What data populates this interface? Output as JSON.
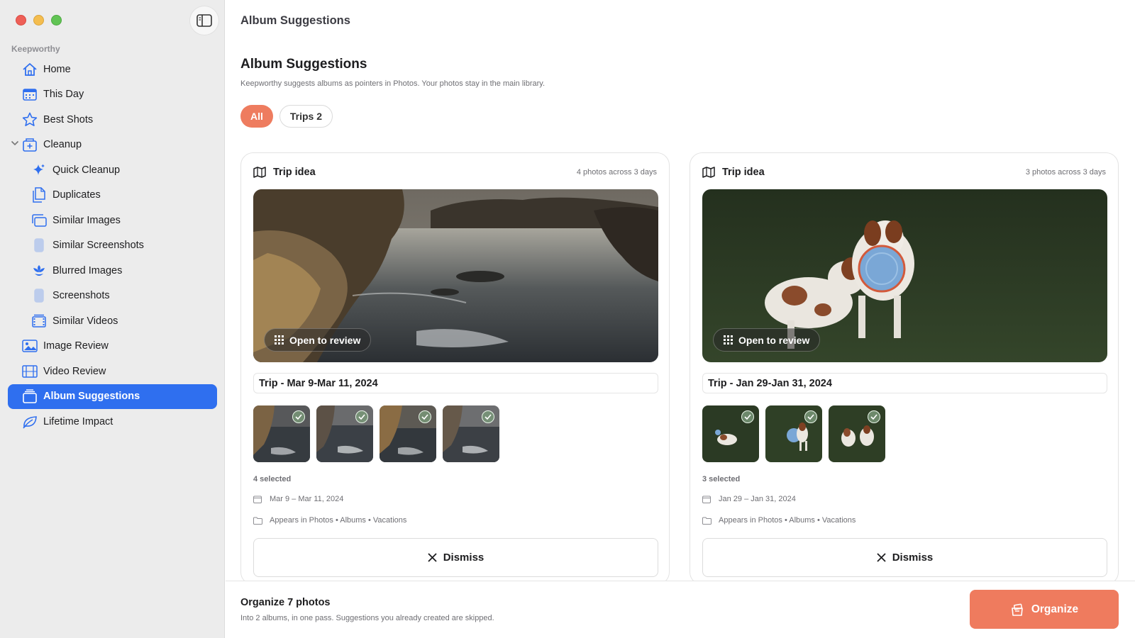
{
  "window": {
    "title": "Album Suggestions"
  },
  "sidebar": {
    "section_label": "Keepworthy",
    "items": [
      {
        "label": "Home",
        "icon": "house-icon"
      },
      {
        "label": "This Day",
        "icon": "calendar-icon"
      },
      {
        "label": "Best Shots",
        "icon": "star-icon"
      },
      {
        "label": "Cleanup",
        "icon": "cleanup-icon",
        "expanded": true
      },
      {
        "label": "Quick Cleanup",
        "icon": "sparkle-icon"
      },
      {
        "label": "Duplicates",
        "icon": "duplicate-doc-icon"
      },
      {
        "label": "Similar Images",
        "icon": "stacked-images-icon"
      },
      {
        "label": "Similar Screenshots",
        "icon": "phone-icon"
      },
      {
        "label": "Blurred Images",
        "icon": "flower-icon"
      },
      {
        "label": "Screenshots",
        "icon": "phone-icon"
      },
      {
        "label": "Similar Videos",
        "icon": "film-stack-icon"
      },
      {
        "label": "Image Review",
        "icon": "photo-icon"
      },
      {
        "label": "Video Review",
        "icon": "film-icon"
      },
      {
        "label": "Album Suggestions",
        "icon": "album-stack-icon",
        "active": true
      },
      {
        "label": "Lifetime Impact",
        "icon": "leaf-icon"
      }
    ]
  },
  "main": {
    "heading": "Album Suggestions",
    "subtitle": "Keepworthy suggests albums as pointers in Photos. Your photos stay in the main library.",
    "filters": [
      {
        "label": "All",
        "active": true
      },
      {
        "label": "Trips 2",
        "active": false
      }
    ],
    "cards": [
      {
        "kind": "Trip idea",
        "meta": "4 photos across 3 days",
        "open_label": "Open to review",
        "album_name": "Trip - Mar 9-Mar 11, 2024",
        "thumb_count": 4,
        "selected_label": "4 selected",
        "date_range": "Mar 9 – Mar 11, 2024",
        "location": "Appears in Photos • Albums • Vacations",
        "dismiss_label": "Dismiss"
      },
      {
        "kind": "Trip idea",
        "meta": "3 photos across 3 days",
        "open_label": "Open to review",
        "album_name": "Trip - Jan 29-Jan 31, 2024",
        "thumb_count": 3,
        "selected_label": "3 selected",
        "date_range": "Jan 29 – Jan 31, 2024",
        "location": "Appears in Photos • Albums • Vacations",
        "dismiss_label": "Dismiss"
      }
    ]
  },
  "footer": {
    "title": "Organize 7 photos",
    "subtitle": "Into 2 albums, in one pass. Suggestions you already created are skipped.",
    "organize_label": "Organize"
  },
  "colors": {
    "accent_blue": "#2f6fef",
    "accent_orange": "#ee7c5f"
  }
}
